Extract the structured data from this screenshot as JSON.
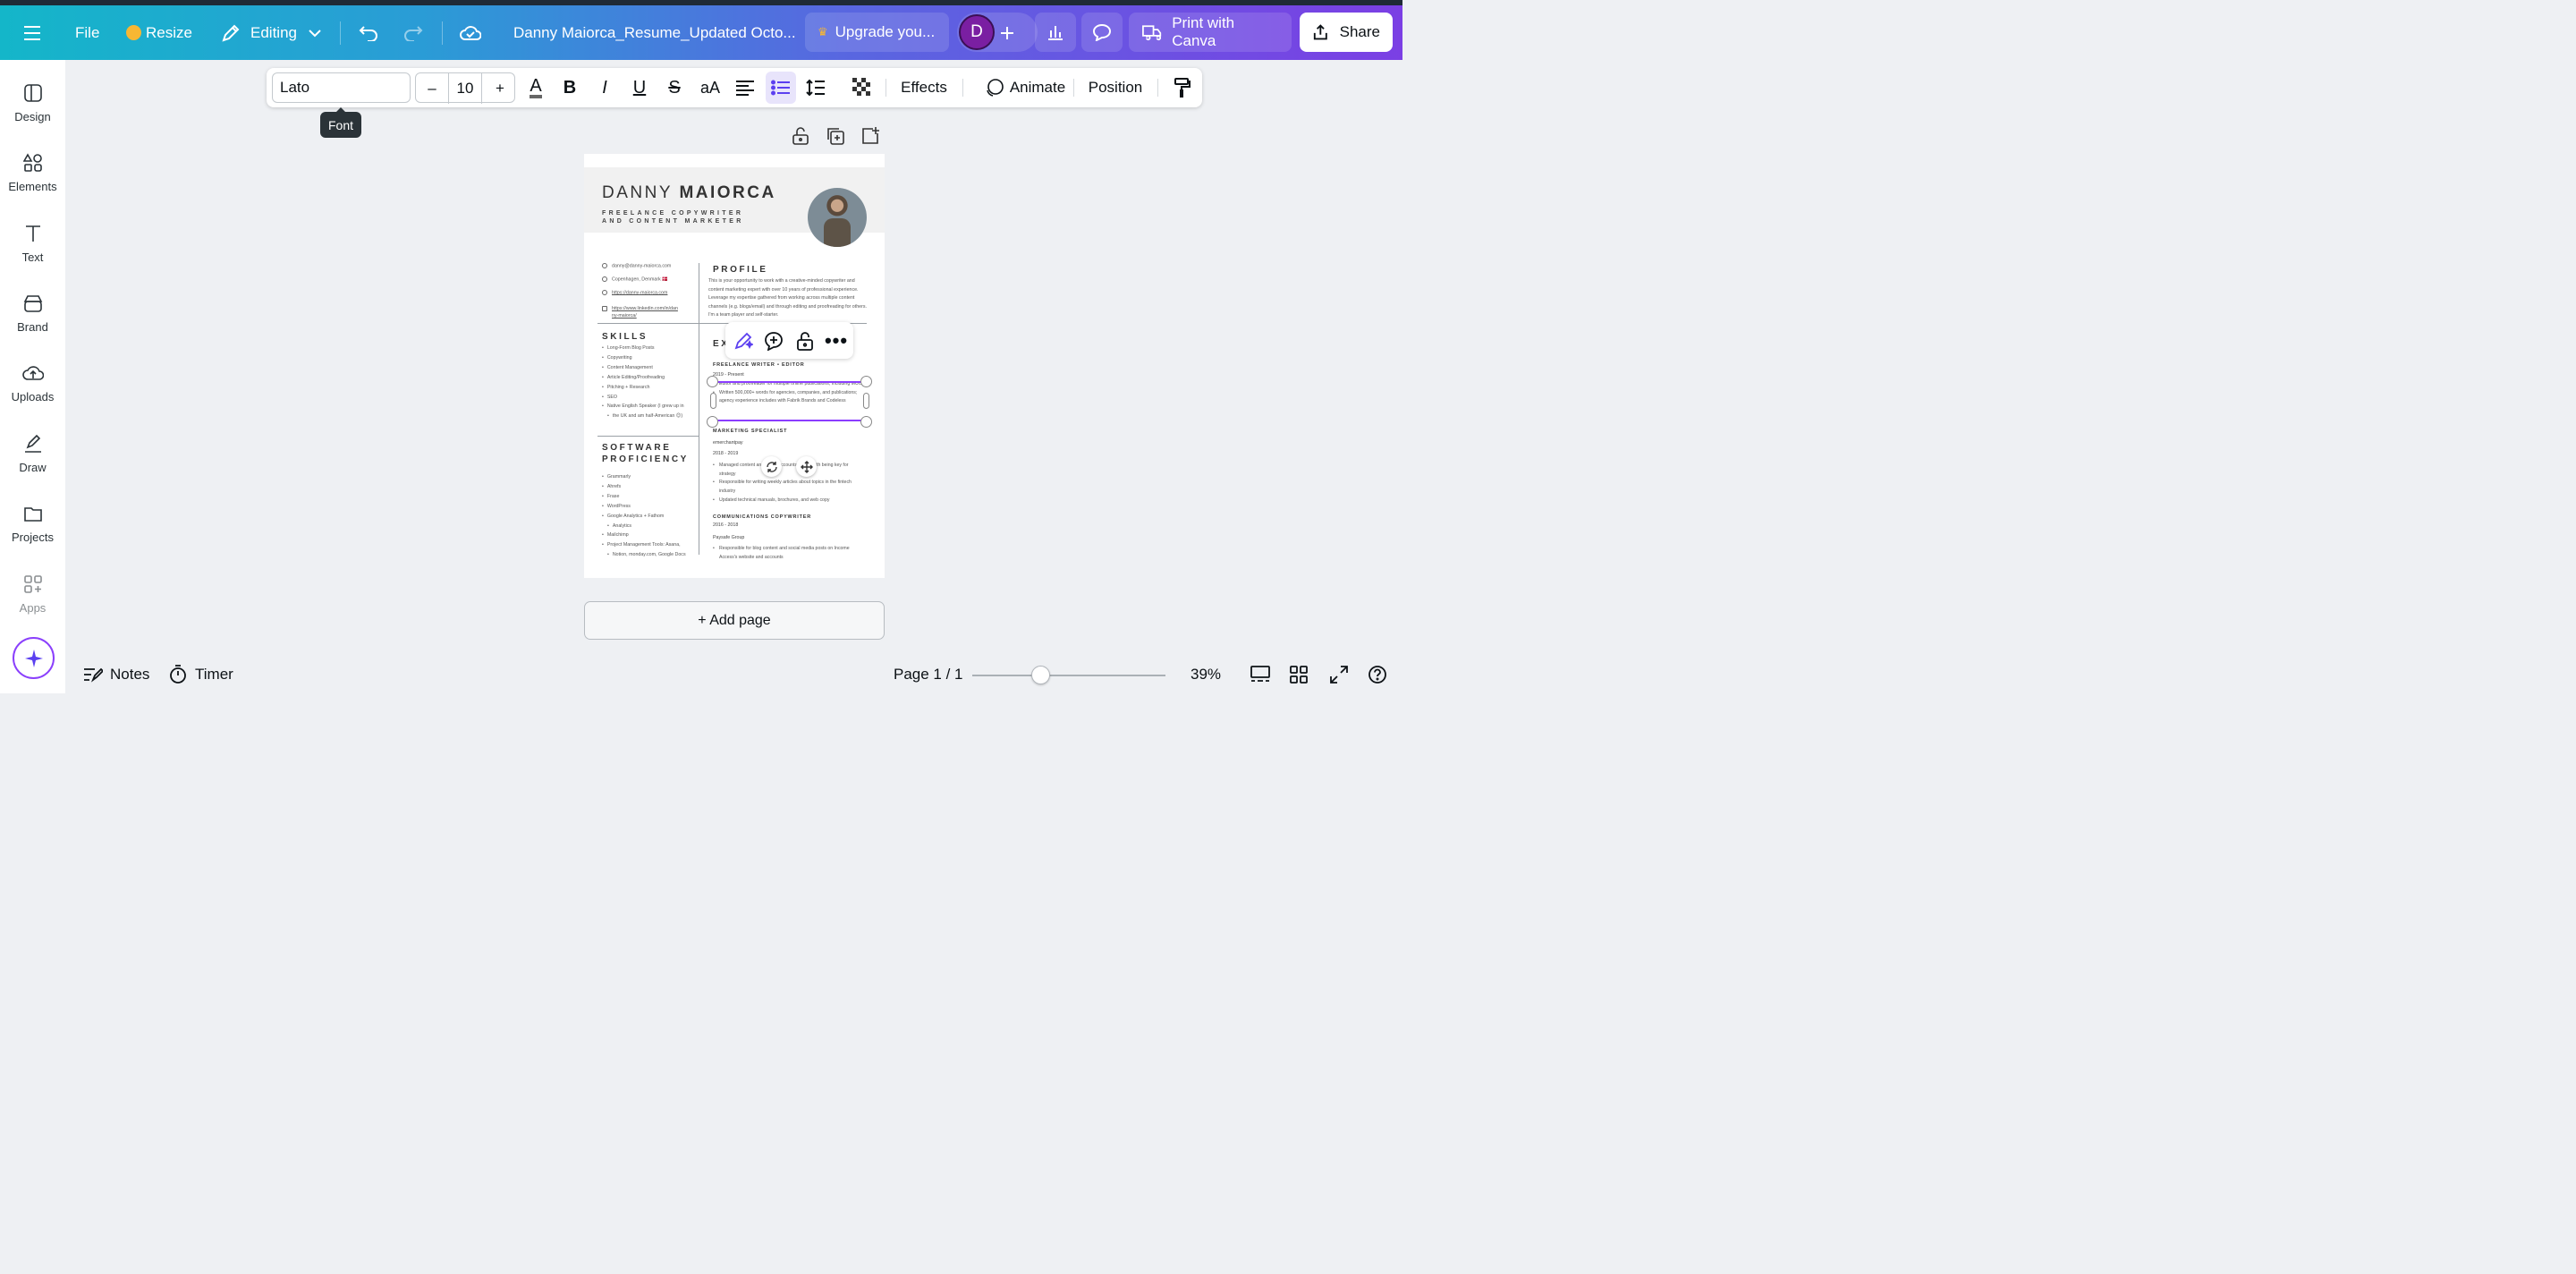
{
  "topbar": {
    "file": "File",
    "resize": "Resize",
    "editing": "Editing",
    "doc_title": "Danny Maiorca_Resume_Updated Octo...",
    "upgrade": "Upgrade you...",
    "avatar_initial": "D",
    "print": "Print with Canva",
    "share": "Share"
  },
  "rail": {
    "design": "Design",
    "elements": "Elements",
    "text": "Text",
    "brand": "Brand",
    "uploads": "Uploads",
    "draw": "Draw",
    "projects": "Projects",
    "apps": "Apps"
  },
  "text_toolbar": {
    "font": "Lato",
    "size": "10",
    "minus": "–",
    "plus": "+",
    "case": "aA",
    "effects": "Effects",
    "animate": "Animate",
    "position": "Position",
    "tooltip": "Font"
  },
  "resume": {
    "first_name": "DANNY",
    "last_name": "MAIORCA",
    "role_line1": "FREELANCE COPYWRITER",
    "role_line2": "AND CONTENT MARKETER",
    "email": "danny@danny-maiorca.com",
    "location": "Copenhagen, Denmark 🇩🇰",
    "website": "https://danny-maiorca.com",
    "linkedin1": "https://www.linkedin.com/in/dan",
    "linkedin2": "ny-maiorca/",
    "skills_title": "SKILLS",
    "skills": [
      "Long-Form Blog Posts",
      "Copywriting",
      "Content Management",
      "Article Editing/Proofreading",
      "Pitching + Research",
      "SEO",
      "Native English Speaker (I grew up in",
      "the UK and am half-American 😊)"
    ],
    "software_title1": "SOFTWARE",
    "software_title2": "PROFICIENCY",
    "software": [
      "Grammarly",
      "Ahrefs",
      "Frase",
      "WordPress",
      "Google Analytics + Fathom",
      "Analytics",
      "Mailchimp",
      "Project Management Tools: Asana,",
      "Notion, monday.com, Google Docs"
    ],
    "profile_title": "PROFILE",
    "profile_text": "This is your opportunity to work with a creative-minded copywriter and content marketing expert with over 10 years of professional experience. Leverage my expertise gathered from working across multiple content channels (e.g. blogs/email) and through editing and proofreading for others. I'm a team player and self-starter.",
    "experience_title": "EX",
    "job1_title": "FREELANCE WRITER • EDITOR",
    "job1_dates": "2019 - Present",
    "job1_b1": "Editor and proofreader for multiple online publications, including MUO",
    "job1_b2": "Written 500,000+ words for agencies, companies, and publications; agency experience includes with Fabrik Brands and Codeless",
    "job2_title": "MARKETING SPECIALIST",
    "job2_company": "emerchantpay",
    "job2_dates": "2018 - 2019",
    "job2_b1": "Managed content and social accounts, along with being key for strategy",
    "job2_b2": "Responsible for writing weekly articles about topics in the fintech industry",
    "job2_b3": "Updated technical manuals, brochures, and web copy",
    "job3_title": "COMMUNICATIONS COPYWRITER",
    "job3_dates": "2016 - 2018",
    "job3_company": "Paysafe Group",
    "job3_b1": "Responsible for blog content and social media posts on Income Access's website and accounts"
  },
  "canvas": {
    "add_page": "+ Add page"
  },
  "bottombar": {
    "notes": "Notes",
    "timer": "Timer",
    "page": "Page 1 / 1",
    "zoom": "39%",
    "zoom_level": 0.39
  },
  "colors": {
    "accent": "#8b3dff",
    "topbar_start": "#14b6c9",
    "topbar_end": "#7b3fe4"
  }
}
